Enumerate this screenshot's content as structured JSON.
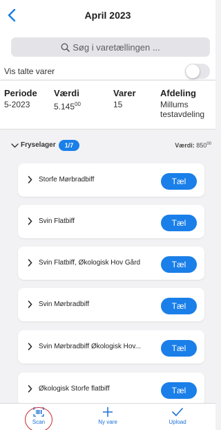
{
  "header": {
    "title": "April 2023",
    "back_icon": "chevron-left-icon"
  },
  "search": {
    "placeholder": "Søg i varetællingen ..."
  },
  "toggle": {
    "label": "Vis talte varer",
    "on": false
  },
  "info": {
    "periode_label": "Periode",
    "periode_value": "5-2023",
    "vaerdi_label": "Værdi",
    "vaerdi_value": "5.145",
    "vaerdi_decimals": "00",
    "varer_label": "Varer",
    "varer_value": "15",
    "afdeling_label": "Afdeling",
    "afdeling_value_line1": "Millums",
    "afdeling_value_line2": "testavdeling"
  },
  "group": {
    "name": "Fryselager",
    "badge": "1/7",
    "value_label": "Værdi:",
    "value": "850",
    "value_decimals": "00"
  },
  "items": [
    {
      "name": "Storfe Mørbradbiff",
      "button": "Tæl"
    },
    {
      "name": "Svin Flatbiff",
      "button": "Tæl"
    },
    {
      "name": "Svin Flatbiff, Økologisk Hov Gård",
      "button": "Tæl"
    },
    {
      "name": "Svin Mørbradbiff",
      "button": "Tæl"
    },
    {
      "name": "Svin Mørbradbiff Økologisk Hov...",
      "button": "Tæl"
    },
    {
      "name": "Økologisk Storfe flatbiff",
      "button": "Tæl"
    }
  ],
  "tabbar": {
    "scan": "Scan",
    "new_item": "Ny vare",
    "upload": "Upload"
  },
  "colors": {
    "accent": "#1a7fe8",
    "scan_highlight": "#c8282e"
  }
}
